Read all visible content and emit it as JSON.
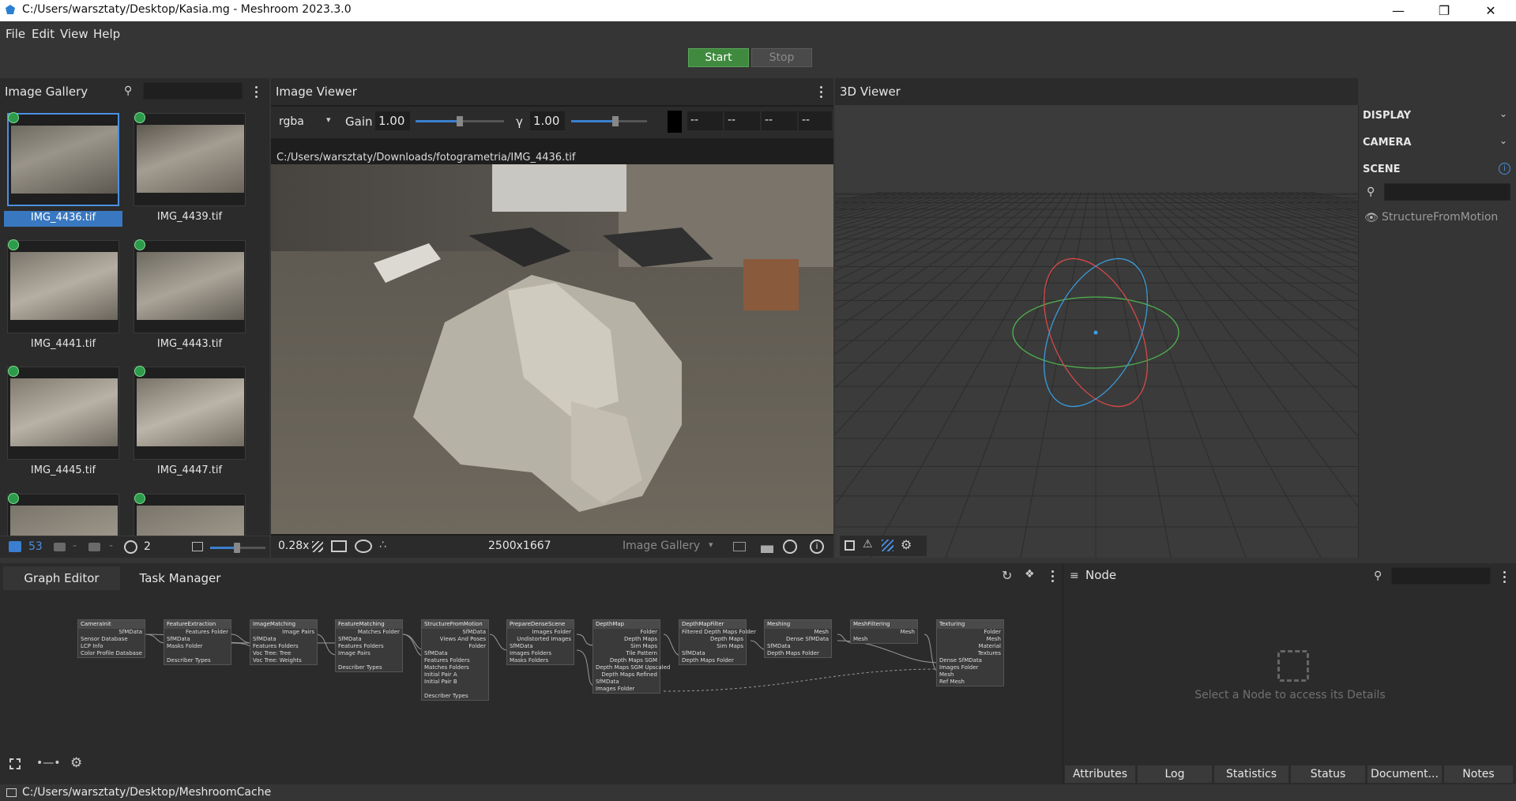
{
  "window": {
    "title": "C:/Users/warsztaty/Desktop/Kasia.mg - Meshroom 2023.3.0"
  },
  "menu": [
    "File",
    "Edit",
    "View",
    "Help"
  ],
  "run": {
    "start": "Start",
    "stop": "Stop"
  },
  "gallery": {
    "title": "Image Gallery",
    "images": [
      "IMG_4436.tif",
      "IMG_4439.tif",
      "IMG_4441.tif",
      "IMG_4443.tif",
      "IMG_4445.tif",
      "IMG_4447.tif"
    ],
    "selected": "IMG_4436.tif",
    "count": "53",
    "cam_count": "-",
    "nocam_count": "-",
    "intrinsics": "2"
  },
  "viewer": {
    "title": "Image Viewer",
    "channel": "rgba",
    "gain_label": "Gain",
    "gain": "1.00",
    "gamma_label": "γ",
    "gamma": "1.00",
    "pixel_values": [
      "--",
      "--",
      "--",
      "--"
    ],
    "path": "C:/Users/warsztaty/Downloads/fotogrametria/IMG_4436.tif",
    "zoom": "0.28x",
    "resolution": "2500x1667",
    "source": "Image Gallery"
  },
  "viewer3d": {
    "title": "3D Viewer",
    "sections": [
      "DISPLAY",
      "CAMERA",
      "SCENE"
    ],
    "scene_item": "StructureFromMotion"
  },
  "bottom": {
    "tabs": [
      "Graph Editor",
      "Task Manager"
    ],
    "node_title": "Node",
    "node_placeholder": "Select a Node to access its Details",
    "node_tabs": [
      "Attributes",
      "Log",
      "Statistics",
      "Status",
      "Document...",
      "Notes"
    ]
  },
  "graph": {
    "nodes": [
      {
        "name": "CameraInit",
        "outs": [
          "SfMData"
        ],
        "ins": [
          "Sensor Database",
          "LCP Info",
          "Color Profile Database"
        ]
      },
      {
        "name": "FeatureExtraction",
        "outs": [
          "Features Folder"
        ],
        "ins": [
          "SfMData",
          "Masks Folder",
          "",
          "Describer Types"
        ]
      },
      {
        "name": "ImageMatching",
        "outs": [
          "Image Pairs"
        ],
        "ins": [
          "SfMData",
          "Features Folders",
          "Voc Tree: Tree",
          "Voc Tree: Weights"
        ]
      },
      {
        "name": "FeatureMatching",
        "outs": [
          "Matches Folder"
        ],
        "ins": [
          "SfMData",
          "Features Folders",
          "Image Pairs",
          "",
          "Describer Types"
        ]
      },
      {
        "name": "StructureFromMotion",
        "outs": [
          "SfMData",
          "Views And Poses",
          "Folder"
        ],
        "ins": [
          "SfMData",
          "Features Folders",
          "Matches Folders",
          "Initial Pair A",
          "Initial Pair B",
          "",
          "Describer Types"
        ]
      },
      {
        "name": "PrepareDenseScene",
        "outs": [
          "Images Folder",
          "Undistorted Images"
        ],
        "ins": [
          "SfMData",
          "Images Folders",
          "Masks Folders"
        ]
      },
      {
        "name": "DepthMap",
        "outs": [
          "Folder",
          "Depth Maps",
          "Sim Maps",
          "Tile Pattern",
          "Depth Maps SGM",
          "Depth Maps SGM Upscaled",
          "Depth Maps Refined"
        ],
        "ins": [
          "SfMData",
          "Images Folder"
        ]
      },
      {
        "name": "DepthMapFilter",
        "outs": [
          "Filtered Depth Maps Folder",
          "Depth Maps",
          "Sim Maps"
        ],
        "ins": [
          "SfMData",
          "Depth Maps Folder"
        ]
      },
      {
        "name": "Meshing",
        "outs": [
          "Mesh",
          "Dense SfMData"
        ],
        "ins": [
          "SfMData",
          "Depth Maps Folder"
        ]
      },
      {
        "name": "MeshFiltering",
        "outs": [
          "Mesh"
        ],
        "ins": [
          "Mesh"
        ]
      },
      {
        "name": "Texturing",
        "outs": [
          "Folder",
          "Mesh",
          "Material",
          "Textures"
        ],
        "ins": [
          "Dense SfMData",
          "Images Folder",
          "Mesh",
          "Ref Mesh"
        ]
      }
    ]
  },
  "statusbar": {
    "cache": "C:/Users/warsztaty/Desktop/MeshroomCache"
  },
  "colors": {
    "accent": "#3978c0",
    "start": "#3f8a3f",
    "bg": "#353535",
    "panel": "#2b2b2b"
  }
}
